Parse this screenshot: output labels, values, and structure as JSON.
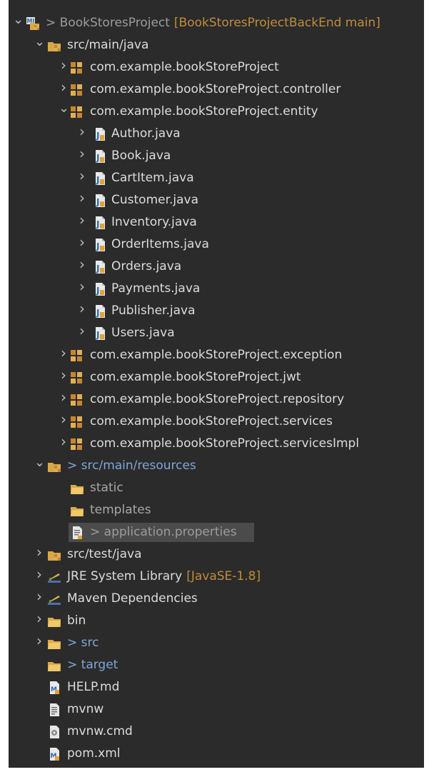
{
  "tree": [
    {
      "depth": 0,
      "expand": "down",
      "icon": "maven-project-icon",
      "label": "BookStoresProject",
      "prefix": "> ",
      "suffix": "[BookStoresProjectBackEnd main]",
      "labelClass": "dec",
      "suffixClass": "tag"
    },
    {
      "depth": 1,
      "expand": "down",
      "icon": "source-folder-icon",
      "label": "src/main/java"
    },
    {
      "depth": 2,
      "expand": "right",
      "icon": "package-icon",
      "label": "com.example.bookStoreProject"
    },
    {
      "depth": 2,
      "expand": "right",
      "icon": "package-icon",
      "label": "com.example.bookStoreProject.controller"
    },
    {
      "depth": 2,
      "expand": "down",
      "icon": "package-icon",
      "label": "com.example.bookStoreProject.entity"
    },
    {
      "depth": 3,
      "expand": "right",
      "icon": "java-file-icon",
      "label": "Author.java"
    },
    {
      "depth": 3,
      "expand": "right",
      "icon": "java-file-icon",
      "label": "Book.java"
    },
    {
      "depth": 3,
      "expand": "right",
      "icon": "java-file-icon",
      "label": "CartItem.java"
    },
    {
      "depth": 3,
      "expand": "right",
      "icon": "java-file-icon",
      "label": "Customer.java"
    },
    {
      "depth": 3,
      "expand": "right",
      "icon": "java-file-icon",
      "label": "Inventory.java"
    },
    {
      "depth": 3,
      "expand": "right",
      "icon": "java-file-icon",
      "label": "OrderItems.java"
    },
    {
      "depth": 3,
      "expand": "right",
      "icon": "java-file-icon",
      "label": "Orders.java"
    },
    {
      "depth": 3,
      "expand": "right",
      "icon": "java-file-icon",
      "label": "Payments.java"
    },
    {
      "depth": 3,
      "expand": "right",
      "icon": "java-file-icon",
      "label": "Publisher.java"
    },
    {
      "depth": 3,
      "expand": "right",
      "icon": "java-file-icon",
      "label": "Users.java"
    },
    {
      "depth": 2,
      "expand": "right",
      "icon": "package-icon",
      "label": "com.example.bookStoreProject.exception"
    },
    {
      "depth": 2,
      "expand": "right",
      "icon": "package-icon",
      "label": "com.example.bookStoreProject.jwt"
    },
    {
      "depth": 2,
      "expand": "right",
      "icon": "package-icon",
      "label": "com.example.bookStoreProject.repository"
    },
    {
      "depth": 2,
      "expand": "right",
      "icon": "package-icon",
      "label": "com.example.bookStoreProject.services"
    },
    {
      "depth": 2,
      "expand": "right",
      "icon": "package-icon",
      "label": "com.example.bookStoreProject.servicesImpl"
    },
    {
      "depth": 1,
      "expand": "down",
      "icon": "source-folder-icon",
      "label": "src/main/resources",
      "prefix": "> ",
      "labelClass": "blue"
    },
    {
      "depth": 2,
      "expand": "none",
      "icon": "folder-icon",
      "label": "static",
      "labelClass": "muted"
    },
    {
      "depth": 2,
      "expand": "none",
      "icon": "folder-icon",
      "label": "templates",
      "labelClass": "muted"
    },
    {
      "depth": 2,
      "expand": "none",
      "icon": "properties-file-icon",
      "label": "application.properties",
      "prefix": "> ",
      "labelClass": "dec",
      "selected": true
    },
    {
      "depth": 1,
      "expand": "right",
      "icon": "source-folder-icon",
      "label": "src/test/java"
    },
    {
      "depth": 1,
      "expand": "right",
      "icon": "library-icon",
      "label": "JRE System Library",
      "suffix": "[JavaSE-1.8]",
      "suffixClass": "tag"
    },
    {
      "depth": 1,
      "expand": "right",
      "icon": "library-icon",
      "label": "Maven Dependencies"
    },
    {
      "depth": 1,
      "expand": "right",
      "icon": "folder-icon",
      "label": "bin"
    },
    {
      "depth": 1,
      "expand": "right",
      "icon": "folder-icon",
      "label": "src",
      "prefix": "> ",
      "labelClass": "blue"
    },
    {
      "depth": 1,
      "expand": "none",
      "icon": "folder-icon",
      "label": "target",
      "prefix": "> ",
      "labelClass": "blue"
    },
    {
      "depth": 1,
      "expand": "none",
      "icon": "markdown-file-icon",
      "label": "HELP.md"
    },
    {
      "depth": 1,
      "expand": "none",
      "icon": "text-file-icon",
      "label": "mvnw"
    },
    {
      "depth": 1,
      "expand": "none",
      "icon": "cmd-file-icon",
      "label": "mvnw.cmd"
    },
    {
      "depth": 1,
      "expand": "none",
      "icon": "pom-file-icon",
      "label": "pom.xml"
    }
  ]
}
